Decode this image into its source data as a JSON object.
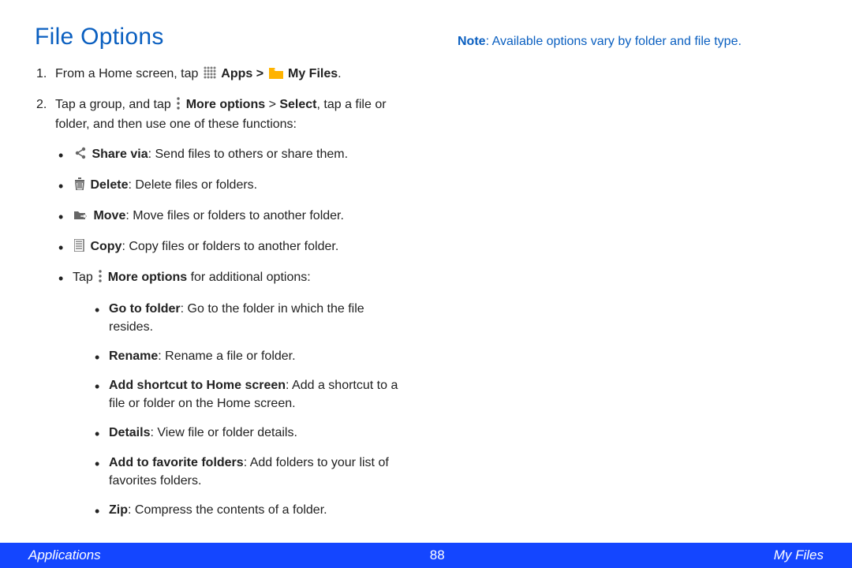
{
  "title": "File Options",
  "note_label": "Note",
  "note_text": ": Available options vary by folder and file type.",
  "step1": {
    "num": "1.",
    "pre": "From a Home screen, tap ",
    "apps": "Apps",
    "gt": " > ",
    "myfiles": "My Files",
    "end": "."
  },
  "step2": {
    "num": "2.",
    "pre": "Tap a group, and tap ",
    "more": "More options",
    "mid": " > ",
    "select": "Select",
    "end": ", tap a file or folder, and then use one of these functions:"
  },
  "bullets": {
    "share": {
      "label": "Share via",
      "desc": ": Send files to others or share them."
    },
    "delete": {
      "label": "Delete",
      "desc": ": Delete files or folders."
    },
    "move": {
      "label": "Move",
      "desc": ": Move files or folders to another folder."
    },
    "copy": {
      "label": "Copy",
      "desc": ": Copy files or folders to another folder."
    },
    "tapmore": {
      "pre": "Tap ",
      "label": "More options",
      "desc": " for additional options:"
    }
  },
  "moreopts": {
    "goto": {
      "label": "Go to folder",
      "desc": ": Go to the folder in which the file resides."
    },
    "rename": {
      "label": "Rename",
      "desc": ": Rename a file or folder."
    },
    "addshortcut": {
      "label": "Add shortcut to Home screen",
      "desc": ": Add a shortcut to a file or folder on the Home screen."
    },
    "details": {
      "label": "Details",
      "desc": ": View file or folder details."
    },
    "addfav": {
      "label": "Add to favorite folders",
      "desc": ": Add folders to your list of favorites folders."
    },
    "zip": {
      "label": "Zip",
      "desc": ": Compress the contents of a folder."
    }
  },
  "footer": {
    "left": "Applications",
    "page": "88",
    "right": "My Files"
  },
  "icons": {
    "appsColor": "#7a7a7a",
    "folderColor": "#ffb300",
    "default": "#666666"
  }
}
